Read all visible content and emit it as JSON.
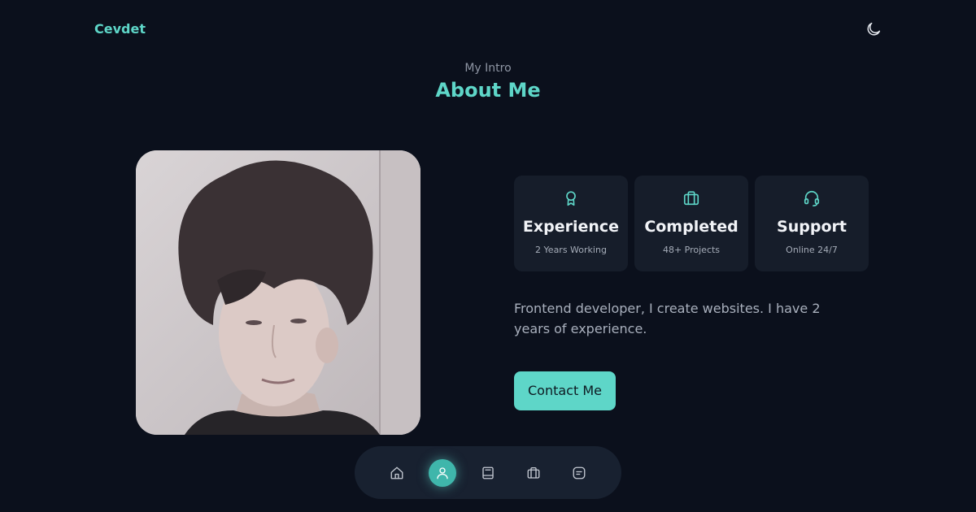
{
  "header": {
    "logo": "Cevdet",
    "theme_icon": "moon-icon"
  },
  "about": {
    "subtitle": "My Intro",
    "title": "About Me",
    "photo_alt": "profile photo",
    "cards": [
      {
        "icon": "award-icon",
        "title": "Experience",
        "subtitle": "2 Years Working"
      },
      {
        "icon": "briefcase-icon",
        "title": "Completed",
        "subtitle": "48+ Projects"
      },
      {
        "icon": "headset-icon",
        "title": "Support",
        "subtitle": "Online 24/7"
      }
    ],
    "description": "Frontend developer, I create websites. I have 2 years of experience.",
    "contact_label": "Contact Me"
  },
  "nav": {
    "items": [
      {
        "icon": "home-icon",
        "active": false
      },
      {
        "icon": "user-icon",
        "active": true
      },
      {
        "icon": "book-icon",
        "active": false
      },
      {
        "icon": "briefcase-icon",
        "active": false
      },
      {
        "icon": "message-icon",
        "active": false
      }
    ]
  },
  "colors": {
    "background": "#0b101c",
    "accent": "#5ed6c8",
    "card": "#161d2a",
    "nav": "#182130"
  }
}
